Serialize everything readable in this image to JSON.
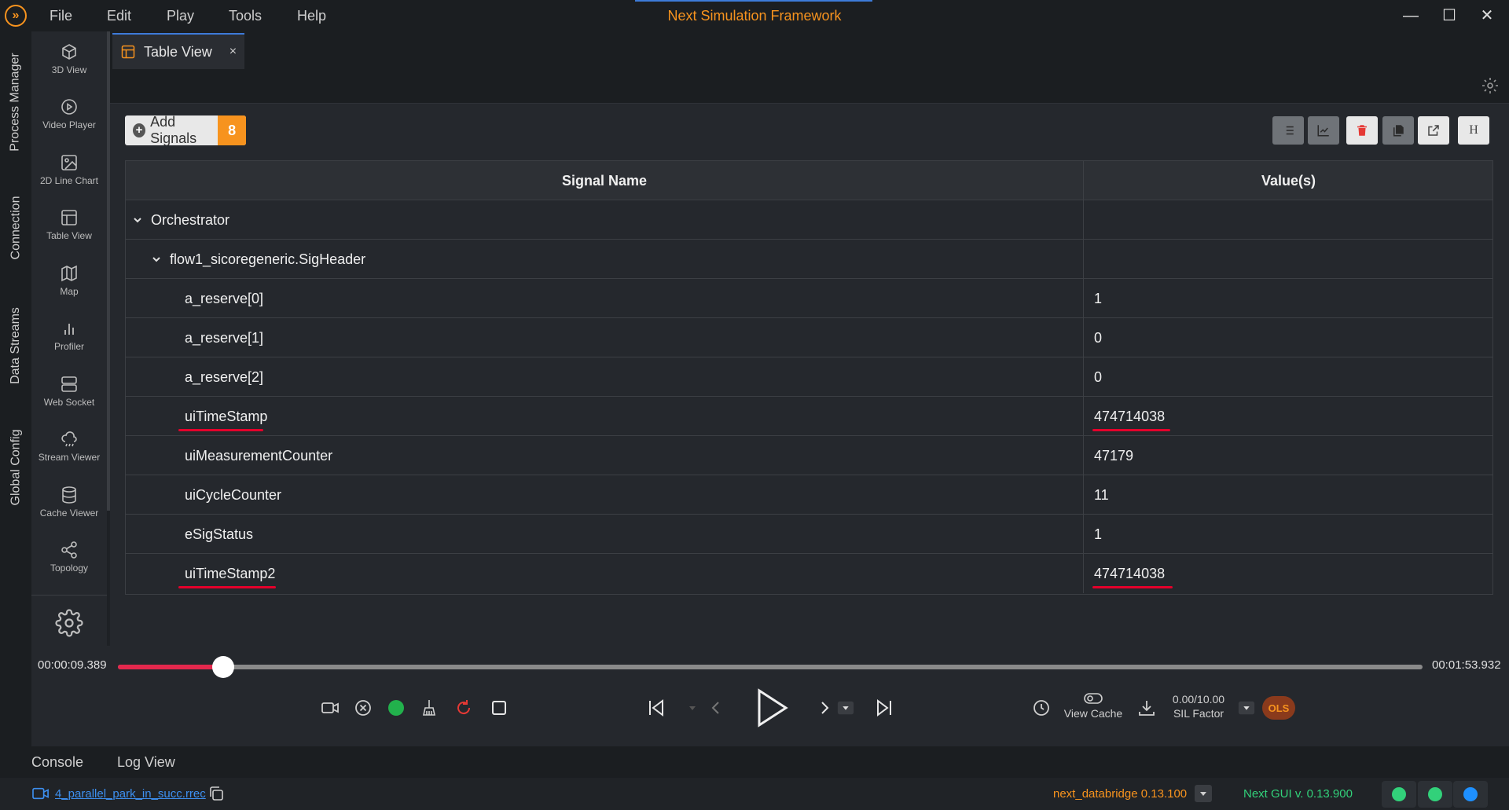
{
  "window": {
    "title": "Next Simulation Framework",
    "menu": [
      "File",
      "Edit",
      "Play",
      "Tools",
      "Help"
    ],
    "controls": {
      "minimize": "—",
      "maximize": "☐",
      "close": "✕"
    }
  },
  "vertical_tabs": [
    "Process Manager",
    "Connection",
    "Data Streams",
    "Global Config"
  ],
  "sidebar": {
    "items": [
      {
        "label": "3D View",
        "icon": "cube-icon"
      },
      {
        "label": "Video Player",
        "icon": "play-circle-icon"
      },
      {
        "label": "2D Line Chart",
        "icon": "image-icon"
      },
      {
        "label": "Table View",
        "icon": "table-icon"
      },
      {
        "label": "Map",
        "icon": "map-icon"
      },
      {
        "label": "Profiler",
        "icon": "bar-chart-icon"
      },
      {
        "label": "Web Socket",
        "icon": "server-icon"
      },
      {
        "label": "Stream Viewer",
        "icon": "cloud-icon"
      },
      {
        "label": "Cache Viewer",
        "icon": "database-icon"
      },
      {
        "label": "Topology",
        "icon": "share-icon"
      }
    ],
    "settings_icon": "gear-icon"
  },
  "tab": {
    "label": "Table View",
    "close": "×"
  },
  "toolbar": {
    "add_signals_label": "Add Signals",
    "signal_count": "8",
    "header_button_label": "H"
  },
  "table": {
    "headers": {
      "name": "Signal Name",
      "value": "Value(s)"
    },
    "rows": [
      {
        "name": "Orchestrator",
        "value": "",
        "level": 0,
        "expandable": true
      },
      {
        "name": "flow1_sicoregeneric.SigHeader",
        "value": "",
        "level": 1,
        "expandable": true
      },
      {
        "name": "a_reserve[0]",
        "value": "1",
        "level": 2
      },
      {
        "name": "a_reserve[1]",
        "value": "0",
        "level": 2
      },
      {
        "name": "a_reserve[2]",
        "value": "0",
        "level": 2
      },
      {
        "name": "uiTimeStamp",
        "value": "474714038",
        "level": 2,
        "highlighted": true
      },
      {
        "name": "uiMeasurementCounter",
        "value": "47179",
        "level": 2
      },
      {
        "name": "uiCycleCounter",
        "value": "11",
        "level": 2
      },
      {
        "name": "eSigStatus",
        "value": "1",
        "level": 2
      },
      {
        "name": "uiTimeStamp2",
        "value": "474714038",
        "level": 2,
        "highlighted": true
      }
    ]
  },
  "playback": {
    "current_time": "00:00:09.389",
    "end_time": "00:01:53.932",
    "progress": 0.081,
    "view_cache_label": "View Cache",
    "sil_value": "0.00/10.00",
    "sil_label": "SIL Factor",
    "ols_label": "OLS"
  },
  "bottom_tabs": [
    "Console",
    "Log View"
  ],
  "status": {
    "file_name": "4_parallel_park_in_succ.rrec",
    "databridge": "next_databridge  0.13.100",
    "gui_version": "Next GUI  v. 0.13.900"
  },
  "colors": {
    "accent": "#f7931e",
    "highlight": "#e4002b",
    "status_green": "#32d17a",
    "status_blue": "#1e90ff",
    "delete_red": "#e53935"
  }
}
